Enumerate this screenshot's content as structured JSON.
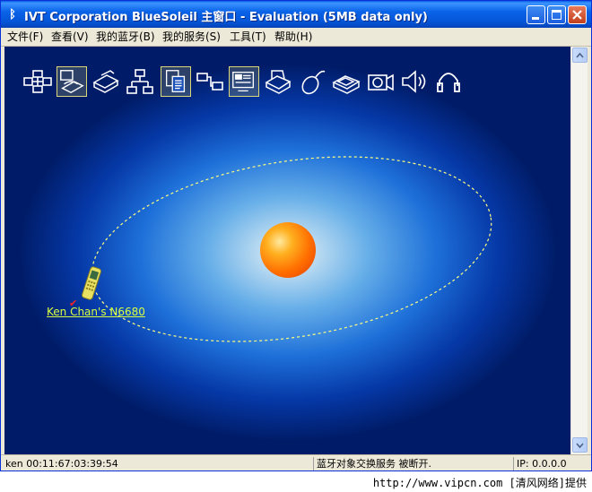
{
  "window": {
    "title": "IVT Corporation BlueSoleil 主窗口 - Evaluation (5MB data only)",
    "title_icon": "bluetooth-icon"
  },
  "menu": {
    "items": [
      "文件(F)",
      "查看(V)",
      "我的蓝牙(B)",
      "我的服务(S)",
      "工具(T)",
      "帮助(H)"
    ]
  },
  "services": {
    "icons": [
      "network-access-icon",
      "dial-up-networking-icon",
      "fax-icon",
      "lan-access-icon",
      "file-transfer-icon",
      "personal-area-network-icon",
      "object-push-icon",
      "printer-icon",
      "mouse-icon",
      "scanner-icon",
      "camera-icon",
      "speaker-icon",
      "headset-icon"
    ]
  },
  "device": {
    "name": "Ken Chan's N6680",
    "icon": "mobile-phone-icon"
  },
  "status": {
    "local_device": "ken 00:11:67:03:39:54",
    "message": "蓝牙对象交换服务 被断开.",
    "ip": "IP: 0.0.0.0"
  },
  "watermark": "http://www.vipcn.com [清风网络]提供",
  "colors": {
    "titlebar": "#0a5fe4",
    "canvas_bg": "#001c68",
    "device_label": "#d8ff40"
  }
}
